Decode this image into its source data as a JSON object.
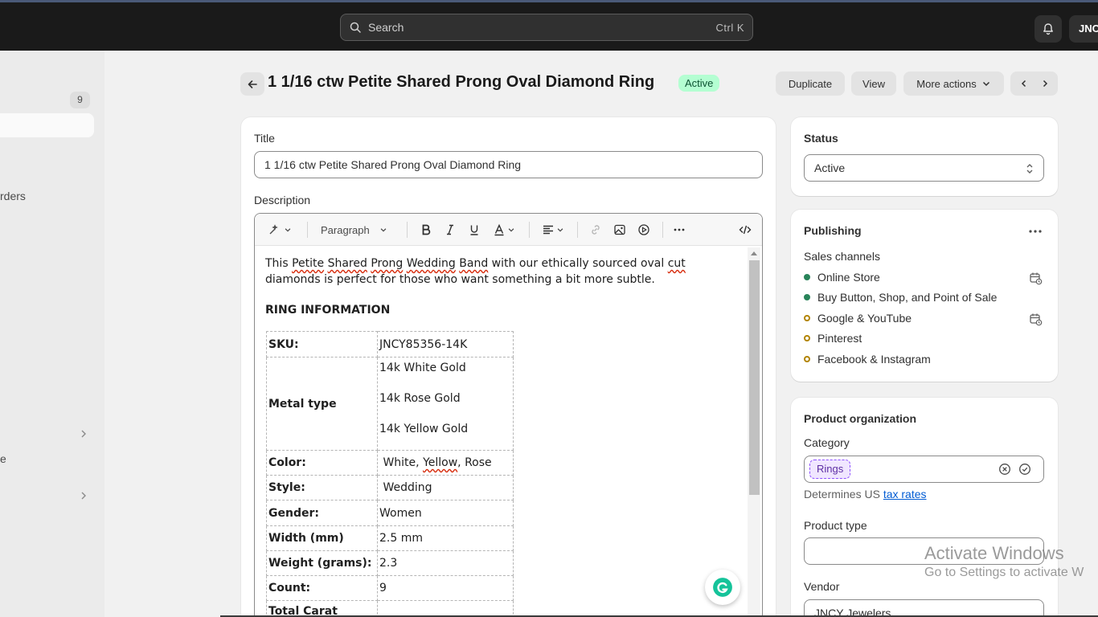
{
  "topbar": {
    "search_placeholder": "Search",
    "search_shortcut": "Ctrl K",
    "account_initials": "JNC"
  },
  "sidebar": {
    "badge": "9",
    "orders_fragment": "rders",
    "e_fragment": "e"
  },
  "header": {
    "title": "1 1/16 ctw Petite Shared Prong Oval Diamond Ring",
    "status": "Active",
    "duplicate": "Duplicate",
    "view": "View",
    "more_actions": "More actions"
  },
  "product": {
    "title_label": "Title",
    "title_value": "1 1/16 ctw Petite Shared Prong Oval Diamond Ring",
    "description_label": "Description",
    "toolbar_paragraph": "Paragraph",
    "desc_parts": [
      "This ",
      "Petite",
      " ",
      "Shared",
      " ",
      "Prong",
      " ",
      "Wedding",
      " ",
      "Band",
      " with our ethically sourced oval ",
      "cut",
      " diamonds is perfect for those who want something a bit more subtle."
    ],
    "ring_info_heading": "RING INFORMATION",
    "rows": [
      {
        "key": "SKU:",
        "value": "JNCY85356-14K"
      },
      {
        "key": "Metal type",
        "values": [
          "14k White Gold",
          "14k Rose Gold",
          "14k Yellow Gold"
        ]
      },
      {
        "key": "Color:",
        "value_parts": [
          "White, ",
          "Yellow",
          ", Rose"
        ]
      },
      {
        "key": "Style:",
        "value": "Wedding"
      },
      {
        "key": "Gender:",
        "value": "Women"
      },
      {
        "key": "Width (mm)",
        "value": "2.5 mm"
      },
      {
        "key": "Weight (grams):",
        "value": "2.3"
      },
      {
        "key": "Count:",
        "value": "9"
      },
      {
        "key": "Total Carat",
        "value": ""
      }
    ]
  },
  "status_card": {
    "label": "Status",
    "value": "Active"
  },
  "publishing": {
    "heading": "Publishing",
    "sales_channels_label": "Sales channels",
    "channels": [
      {
        "name": "Online Store",
        "active": true
      },
      {
        "name": "Buy Button, Shop, and Point of Sale",
        "active": true
      },
      {
        "name": "Google & YouTube",
        "active": false
      },
      {
        "name": "Pinterest",
        "active": false
      },
      {
        "name": "Facebook & Instagram",
        "active": false
      }
    ]
  },
  "organization": {
    "heading": "Product organization",
    "category_label": "Category",
    "category_tag": "Rings",
    "hint_prefix": "Determines US ",
    "hint_link": "tax rates",
    "product_type_label": "Product type",
    "product_type_value": "",
    "vendor_label": "Vendor",
    "vendor_value": "JNCY Jewelers"
  },
  "watermark": {
    "line1": "Activate Windows",
    "line2": "Go to Settings to activate W"
  },
  "colors": {
    "topbar_bg": "#1a1a1a",
    "active_badge_bg": "#b4fed2",
    "active_dot": "#29845a",
    "inactive_dot": "#b28400",
    "link": "#005bd3"
  }
}
